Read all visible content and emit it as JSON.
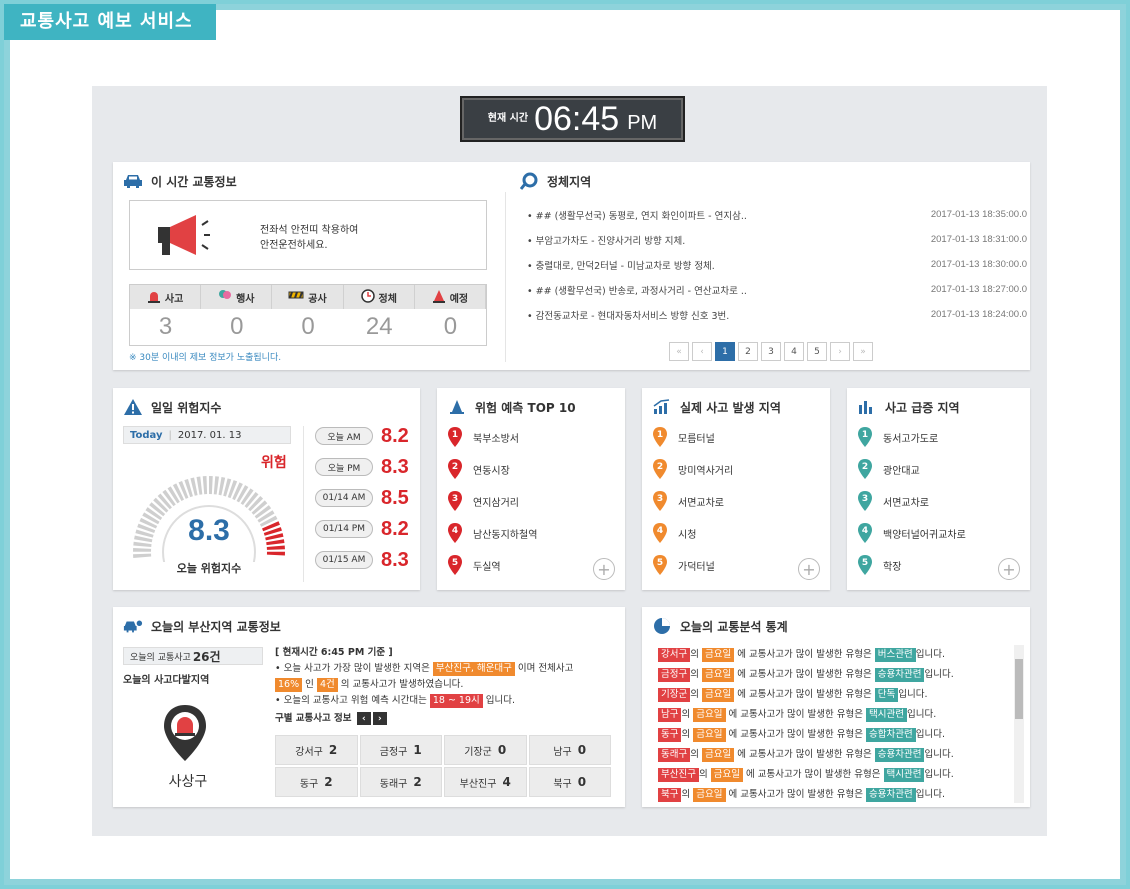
{
  "app_title": "교통사고 예보 서비스",
  "clock": {
    "label": "현재 시간",
    "time": "06:45",
    "ampm": "PM"
  },
  "traffic_now": {
    "title": "이 시간 교통정보",
    "message_line1": "전좌석 안전띠 착용하여",
    "message_line2": "안전운전하세요.",
    "stats": [
      {
        "label": "사고",
        "value": "3",
        "icon": "siren-icon"
      },
      {
        "label": "행사",
        "value": "0",
        "icon": "balloon-icon"
      },
      {
        "label": "공사",
        "value": "0",
        "icon": "barrier-icon"
      },
      {
        "label": "정체",
        "value": "24",
        "icon": "clock-icon"
      },
      {
        "label": "예정",
        "value": "0",
        "icon": "cone-icon"
      }
    ],
    "note": "※ 30분 이내의 제보 정보가 노출됩니다."
  },
  "congestion": {
    "title": "정체지역",
    "items": [
      {
        "text": "## (생활무선국) 동평로, 연지 화인이파트 - 연지삼..",
        "date": "2017-01-13 18:35:00.0"
      },
      {
        "text": "부암고가차도 - 진양사거리 방향 지체.",
        "date": "2017-01-13 18:31:00.0"
      },
      {
        "text": "충렬대로, 만덕2터널 - 미남교차로 방향 정체.",
        "date": "2017-01-13 18:30:00.0"
      },
      {
        "text": "## (생활무선국) 반송로, 과정사거리 - 연산교차로 ..",
        "date": "2017-01-13 18:27:00.0"
      },
      {
        "text": "감전동교차로 - 현대자동차서비스 방향 신호 3번.",
        "date": "2017-01-13 18:24:00.0"
      }
    ],
    "pages": [
      "1",
      "2",
      "3",
      "4",
      "5"
    ],
    "nav": {
      "first": "«",
      "prev": "‹",
      "next": "›",
      "last": "»"
    }
  },
  "risk": {
    "title": "일일 위험지수",
    "today_label": "Today",
    "date": "2017. 01. 13",
    "gauge_value": "8.3",
    "gauge_level": 0.83,
    "level_text": "위험",
    "gauge_caption": "오늘 위험지수",
    "slots": [
      {
        "label": "오늘 AM",
        "value": "8.2"
      },
      {
        "label": "오늘 PM",
        "value": "8.3"
      },
      {
        "label": "01/14 AM",
        "value": "8.5"
      },
      {
        "label": "01/14 PM",
        "value": "8.2"
      },
      {
        "label": "01/15 AM",
        "value": "8.3"
      }
    ]
  },
  "top10": {
    "title": "위험 예측 TOP 10",
    "color": "#d9262b",
    "items": [
      "북부소방서",
      "연동시장",
      "연지삼거리",
      "남산동지하철역",
      "두실역"
    ]
  },
  "actual": {
    "title": "실제 사고 발생 지역",
    "color": "#f08a2e",
    "items": [
      "모름터널",
      "망미역사거리",
      "서면교차로",
      "시청",
      "가덕터널"
    ]
  },
  "surge": {
    "title": "사고 급증 지역",
    "color": "#3fa6a0",
    "items": [
      "동서고가도로",
      "광안대교",
      "서면교차로",
      "백양터널어귀교차로",
      "학장"
    ]
  },
  "busan": {
    "title": "오늘의 부산지역 교통정보",
    "count_label": "오늘의 교통사고",
    "count": "26건",
    "hot_label": "오늘의 사고다발지역",
    "district": "사상구",
    "header": "[ 현재시간 6:45 PM 기준 ]",
    "line1_a": "• 오늘 사고가 가장 많이 발생한 지역은",
    "line1_tag": "부산진구, 해운대구",
    "line1_b": "이며 전체사고",
    "line2_tag1": "16%",
    "line2_a": "인",
    "line2_tag2": "4건",
    "line2_b": "의 교통사고가 발생하였습니다.",
    "line3_a": "• 오늘의 교통사고 위험 예측 시간대는",
    "line3_tag": "18 ~ 19시",
    "line3_b": "입니다.",
    "grid_title": "구별 교통사고 정보",
    "districts": [
      {
        "name": "강서구",
        "n": "2"
      },
      {
        "name": "금정구",
        "n": "1"
      },
      {
        "name": "기장군",
        "n": "0"
      },
      {
        "name": "남구",
        "n": "0"
      },
      {
        "name": "동구",
        "n": "2"
      },
      {
        "name": "동래구",
        "n": "2"
      },
      {
        "name": "부산진구",
        "n": "4"
      },
      {
        "name": "북구",
        "n": "0"
      }
    ]
  },
  "analysis": {
    "title": "오늘의 교통분석 통계",
    "day": "금요일",
    "mid": "에 교통사고가 많이 발생한 유형은",
    "end": "입니다.",
    "rows": [
      {
        "gu": "강서구",
        "josa": "의",
        "type": "버스관련"
      },
      {
        "gu": "금정구",
        "josa": "의",
        "type": "승용차관련"
      },
      {
        "gu": "기장군",
        "josa": "의",
        "type": "단독"
      },
      {
        "gu": "남구",
        "josa": "의",
        "type": "택시관련"
      },
      {
        "gu": "동구",
        "josa": "의",
        "type": "승합차관련"
      },
      {
        "gu": "동래구",
        "josa": "의",
        "type": "승용차관련"
      },
      {
        "gu": "부산진구",
        "josa": "의",
        "type": "택시관련"
      },
      {
        "gu": "북구",
        "josa": "의",
        "type": "승용차관련"
      }
    ]
  }
}
